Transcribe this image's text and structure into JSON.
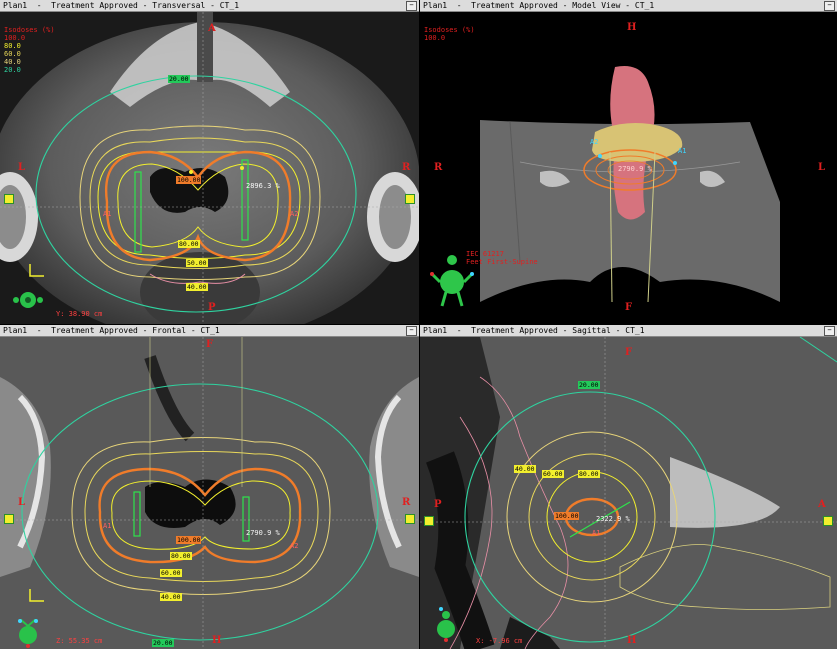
{
  "colors": {
    "iso100": "#f07c2a",
    "iso80": "#f2ef2e",
    "iso60": "#e9d85a",
    "iso40": "#e7d47a",
    "iso20": "#2fd3a0",
    "orient": "#e02020"
  },
  "panes": {
    "transversal": {
      "title": "Plan1  -  Treatment Approved - Transversal - CT_1",
      "header_title": "Isodoses (%)",
      "levels": [
        "100.0",
        "80.0",
        "60.0",
        "40.0",
        "20.0"
      ],
      "orient": {
        "top": "A",
        "bottom": "P",
        "left": "L",
        "right": "R"
      },
      "iso_labels": {
        "i20": "20.00",
        "i100": "100.00",
        "i80": "80.00",
        "i50": "50.00",
        "i40": "40.00"
      },
      "dose_readout": "2896.3 %",
      "app_a1": "A1",
      "app_a2": "A2",
      "scale_text": "Y: 38.90 cm"
    },
    "model": {
      "title": "Plan1  -  Treatment Approved - Model View - CT_1",
      "header_title": "Isodoses (%)",
      "header_value": "100.0",
      "orient": {
        "top": "H",
        "bottom": "F",
        "left": "R",
        "right": "L"
      },
      "app_a1": "A1",
      "app_a2": "A2",
      "dose_readout": "2790.9 %",
      "patient_label": "IEC 61217",
      "patient_pos": "Feet First-Supine"
    },
    "frontal": {
      "title": "Plan1  -  Treatment Approved - Frontal - CT_1",
      "orient": {
        "top": "F",
        "bottom": "H",
        "left": "L",
        "right": "R"
      },
      "iso_labels": {
        "i100": "100.00",
        "i80": "80.00",
        "i60": "60.00",
        "i40": "40.00",
        "i20": "20.00"
      },
      "dose_readout": "2790.9 %",
      "app_a1": "A1",
      "app_a2": "A2",
      "scale_text": "Z: 55.35 cm"
    },
    "sagittal": {
      "title": "Plan1  -  Treatment Approved - Sagittal - CT_1",
      "orient": {
        "top": "F",
        "bottom": "H",
        "left": "P",
        "right": "A"
      },
      "iso_labels": {
        "i20": "20.00",
        "i40": "40.00",
        "i60": "60.00",
        "i80": "80.00",
        "i100": "100.00"
      },
      "dose_readout": "2322.9 %",
      "app_a1": "A1",
      "scale_text": "X: -7.96 cm"
    }
  },
  "window_button": "−"
}
